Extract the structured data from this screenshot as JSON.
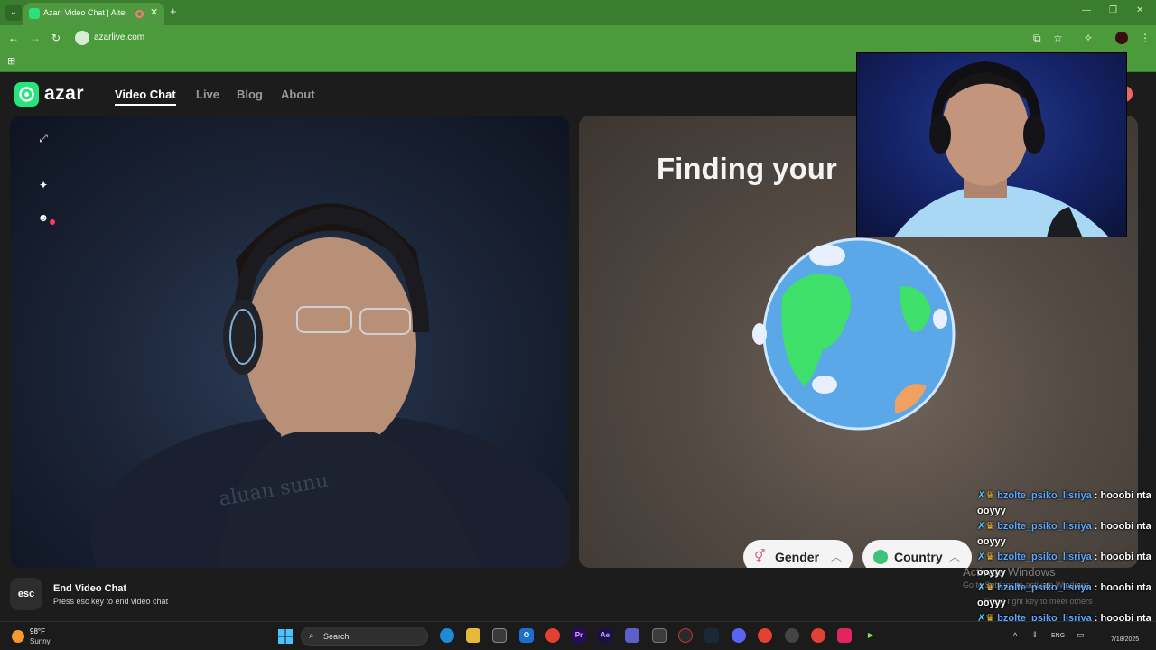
{
  "browser": {
    "tab_title": "Azar: Video Chat | Alternati",
    "url": "azarlive.com"
  },
  "site": {
    "logo_text": "azar",
    "nav": [
      "Video Chat",
      "Live",
      "Blog",
      "About"
    ]
  },
  "stage": {
    "searching_text": "Finding your",
    "filters": [
      {
        "label": "Gender",
        "icon": "gender-icon"
      },
      {
        "label": "Country",
        "icon": "globe-icon"
      }
    ]
  },
  "end_chat": {
    "key": "esc",
    "title": "End Video Chat",
    "subtitle": "Press esc key to end video chat"
  },
  "chat_overlay": [
    {
      "user": "bzolte_psiko_lisriya",
      "message": ": hooobi nta ooyyy"
    },
    {
      "user": "bzolte_psiko_lisriya",
      "message": ": hooobi nta ooyyy"
    },
    {
      "user": "bzolte_psiko_lisriya",
      "message": ": hooobi nta ooyyy"
    },
    {
      "user": "bzolte_psiko_lisriya",
      "message": ": hooobi nta ooyyy"
    },
    {
      "user": "bzolte_psiko_lisriya",
      "message": ": hooobi nta ooyyy"
    }
  ],
  "watermark": {
    "title": "Activate Windows",
    "subtitle": "Go to Settings to activate Windows.",
    "hint": "Press right key to meet others"
  },
  "taskbar": {
    "weather_temp": "98°F",
    "weather_desc": "Sunny",
    "search_placeholder": "Search",
    "language": "ENG",
    "date": "7/18/2025"
  },
  "colors": {
    "browser_green": "#4b9a3c",
    "brand_green": "#29e37d",
    "page_bg": "#1c1c1c"
  }
}
